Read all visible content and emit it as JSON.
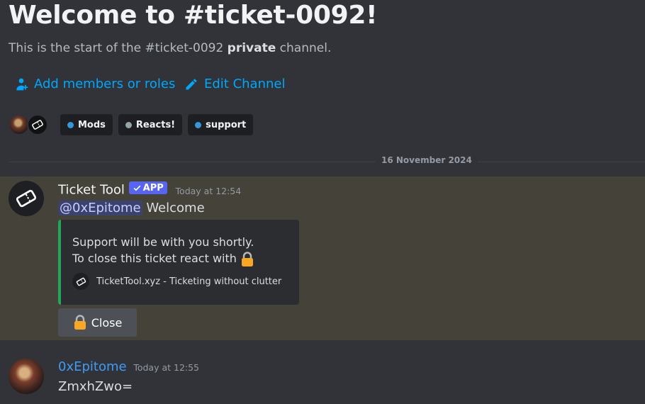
{
  "welcome": {
    "title": "Welcome to #ticket-0092!",
    "subtitle_pre": "This is the start of the #ticket-0092 ",
    "subtitle_bold": "private",
    "subtitle_post": " channel."
  },
  "actions": {
    "add_members": "Add members or roles",
    "edit_channel": "Edit Channel"
  },
  "roles": [
    {
      "label": "Mods",
      "color": "#3498db"
    },
    {
      "label": "Reacts!",
      "color": "#95a5a6"
    },
    {
      "label": "support",
      "color": "#3498db"
    }
  ],
  "date_divider": "16 November 2024",
  "messages": [
    {
      "author": "Ticket Tool",
      "badge": "APP",
      "timestamp": "Today at 12:54",
      "mention": "@0xEpitome",
      "text": " Welcome",
      "embed": {
        "line1": "Support will be with you shortly.",
        "line2": "To close this ticket react with",
        "footer": "TicketTool.xyz - Ticketing without clutter"
      },
      "button_label": "Close"
    },
    {
      "author": "0xEpitome",
      "timestamp": "Today at 12:55",
      "text": "ZmxhZwo="
    }
  ],
  "colors": {
    "background": "#313338",
    "highlight": "#444239",
    "link": "#00a8fc",
    "embed_border": "#23a55a",
    "app_badge": "#5865f2",
    "user_name": "#3f9cf5"
  },
  "icons": [
    "add-members-icon",
    "pencil-icon",
    "ticket-icon",
    "lock-icon",
    "checkmark-icon"
  ]
}
